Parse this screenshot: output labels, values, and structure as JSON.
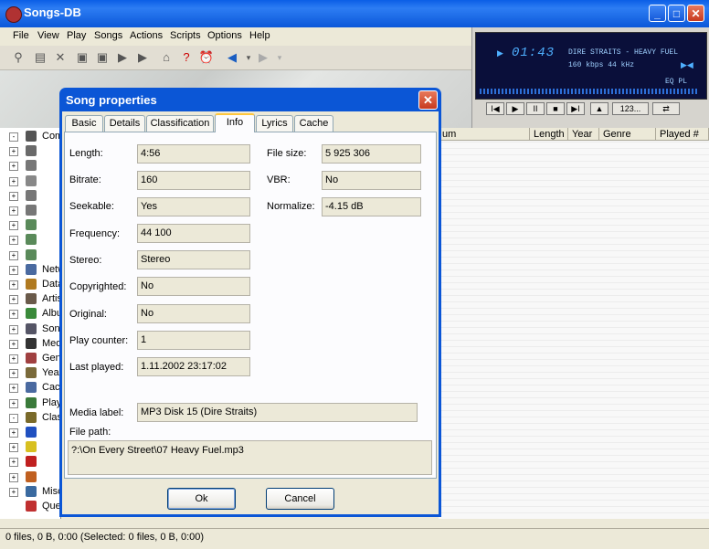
{
  "app": {
    "title": "Songs-DB",
    "menu": [
      "File",
      "View",
      "Play",
      "Songs",
      "Actions",
      "Scripts",
      "Options",
      "Help"
    ]
  },
  "player": {
    "time": "01:43",
    "track": "DIRE STRAITS - HEAVY FUEL",
    "bitrate": "160 kbps   44 kHz",
    "eq": "EQ  PL",
    "controls": [
      "I◀",
      "▶",
      "II",
      "■",
      "▶I",
      "▲",
      "123...",
      "⇄"
    ]
  },
  "tree": {
    "items": [
      {
        "plus": "-",
        "label": "Comp"
      },
      {
        "plus": "+",
        "label": ""
      },
      {
        "plus": "+",
        "label": ""
      },
      {
        "plus": "+",
        "label": ""
      },
      {
        "plus": "+",
        "label": ""
      },
      {
        "plus": "+",
        "label": ""
      },
      {
        "plus": "+",
        "label": ""
      },
      {
        "plus": "+",
        "label": ""
      },
      {
        "plus": "+",
        "label": ""
      },
      {
        "plus": "+",
        "label": "Netw"
      },
      {
        "plus": "+",
        "label": "Data"
      },
      {
        "plus": "+",
        "label": "Artis"
      },
      {
        "plus": "+",
        "label": "Albu"
      },
      {
        "plus": "+",
        "label": "Song"
      },
      {
        "plus": "+",
        "label": "Medi"
      },
      {
        "plus": "+",
        "label": "Genr"
      },
      {
        "plus": "+",
        "label": "Year"
      },
      {
        "plus": "+",
        "label": "Cach"
      },
      {
        "plus": "+",
        "label": "Play"
      },
      {
        "plus": "-",
        "label": "Class"
      },
      {
        "plus": "+",
        "label": ""
      },
      {
        "plus": "+",
        "label": ""
      },
      {
        "plus": "+",
        "label": ""
      },
      {
        "plus": "+",
        "label": ""
      },
      {
        "plus": "+",
        "label": "Misc"
      },
      {
        "plus": "",
        "label": "Que"
      }
    ]
  },
  "list": {
    "columns": [
      "um",
      "Length",
      "Year",
      "Genre",
      "Played #"
    ]
  },
  "status": "0 files, 0 B, 0:00 (Selected: 0 files, 0 B, 0:00)",
  "dialog": {
    "title": "Song properties",
    "close": "✕",
    "tabs": [
      "Basic",
      "Details",
      "Classification",
      "Info",
      "Lyrics",
      "Cache"
    ],
    "active_tab": "Info",
    "fields_left": [
      {
        "label": "Length:",
        "value": "4:56"
      },
      {
        "label": "Bitrate:",
        "value": "160"
      },
      {
        "label": "Seekable:",
        "value": "Yes"
      },
      {
        "label": "Frequency:",
        "value": "44 100"
      },
      {
        "label": "Stereo:",
        "value": "Stereo"
      },
      {
        "label": "Copyrighted:",
        "value": "No"
      },
      {
        "label": "Original:",
        "value": "No"
      },
      {
        "label": "Play counter:",
        "value": "1"
      },
      {
        "label": "Last played:",
        "value": "1.11.2002 23:17:02"
      }
    ],
    "fields_right": [
      {
        "label": "File size:",
        "value": "5 925 306"
      },
      {
        "label": "VBR:",
        "value": "No"
      },
      {
        "label": "Normalize:",
        "value": "-4.15 dB"
      }
    ],
    "media_label": {
      "label": "Media label:",
      "value": "MP3 Disk 15  (Dire Straits)"
    },
    "file_path": {
      "label": "File path:",
      "value": "?:\\On Every Street\\07 Heavy Fuel.mp3"
    },
    "ok_label": "Ok",
    "cancel_label": "Cancel"
  }
}
